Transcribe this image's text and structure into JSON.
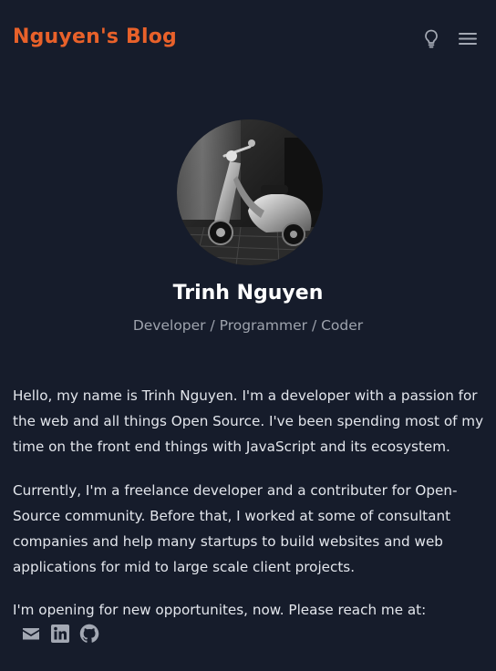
{
  "header": {
    "brand": "Nguyen's Blog",
    "theme_toggle_icon": "lightbulb-icon",
    "menu_icon": "hamburger-menu-icon"
  },
  "profile": {
    "avatar_icon": "scooter-photo",
    "name": "Trinh Nguyen",
    "role": "Developer / Programmer / Coder"
  },
  "bio": {
    "paragraph_1": "Hello, my name is Trinh Nguyen. I'm a developer with a passion for the web and all things Open Source. I've been spending most of my time on the front end things with JavaScript and its ecosystem.",
    "paragraph_2": "Currently, I'm a freelance developer and a contributer for Open-Source community. Before that, I worked at some of consultant companies and help many startups to build websites and web applications for mid to large scale client projects.",
    "paragraph_3": "I'm opening for new opportunites, now. Please reach me at:"
  },
  "socials": [
    "email-icon",
    "linkedin-icon",
    "github-icon"
  ],
  "colors": {
    "background": "#161c2b",
    "brand": "#e8612a",
    "text": "#e3e6ec",
    "muted": "#9ea3ad",
    "icon": "#a3a8b3"
  }
}
